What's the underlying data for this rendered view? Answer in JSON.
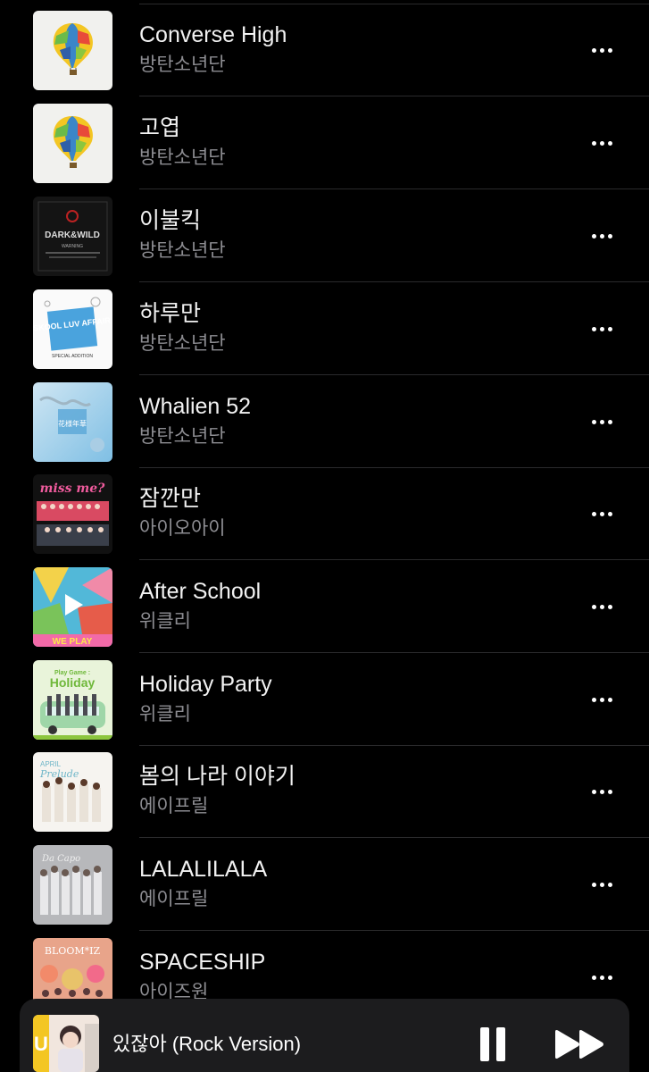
{
  "tracks": [
    {
      "title": "Converse High",
      "artist": "방탄소년단",
      "art": "balloon"
    },
    {
      "title": "고엽",
      "artist": "방탄소년단",
      "art": "balloon"
    },
    {
      "title": "이불킥",
      "artist": "방탄소년단",
      "art": "darkwild"
    },
    {
      "title": "하루만",
      "artist": "방탄소년단",
      "art": "skoolluv"
    },
    {
      "title": "Whalien 52",
      "artist": "방탄소년단",
      "art": "hwayang"
    },
    {
      "title": "잠깐만",
      "artist": "아이오아이",
      "art": "missme"
    },
    {
      "title": "After School",
      "artist": "위클리",
      "art": "weplay"
    },
    {
      "title": "Holiday Party",
      "artist": "위클리",
      "art": "holiday"
    },
    {
      "title": "봄의 나라 이야기",
      "artist": "에이프릴",
      "art": "prelude"
    },
    {
      "title": "LALALILALA",
      "artist": "에이프릴",
      "art": "dacapo"
    },
    {
      "title": "SPACESHIP",
      "artist": "아이즈원",
      "art": "bloomiz"
    }
  ],
  "album_art_text": {
    "darkwild": "DARK&WILD",
    "darkwild_sub": "WARNING",
    "skoolluv": "SKOOL LUV AFFAIR",
    "skoolluv_sub": "SPECIAL ADDITION",
    "hwayang": "花様年華",
    "missme": "miss me?",
    "weplay": "WE PLAY",
    "holiday_top": "Play Game :",
    "holiday": "Holiday",
    "prelude_top": "APRIL",
    "prelude": "Prelude",
    "dacapo": "Da Capo",
    "bloomiz": "BLOOM*IZ"
  },
  "now_playing": {
    "title": "있잖아 (Rock Version)",
    "pause_icon": "pause-icon",
    "next_icon": "forward-icon"
  },
  "colors": {
    "background": "#000000",
    "secondary_text": "#8d8d92",
    "separator": "#2a2a2c",
    "player_bg": "#1c1c1e"
  }
}
